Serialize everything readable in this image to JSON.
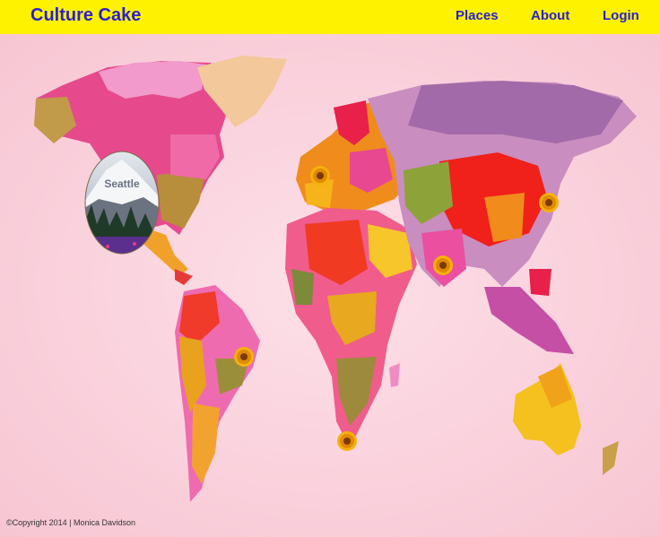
{
  "app": {
    "brand": "Culture Cake"
  },
  "nav": {
    "items": [
      {
        "label": "Places"
      },
      {
        "label": "About"
      },
      {
        "label": "Login"
      }
    ]
  },
  "map": {
    "places": [
      {
        "name": "Seattle"
      }
    ],
    "marker_icon": "sunflower-icon"
  },
  "footer": {
    "copyright": "©Copyright 2014 | Monica Davidson"
  },
  "colors": {
    "header_bg": "#fff200",
    "link": "#2a1fd6",
    "page_bg": "#fbd3de"
  }
}
